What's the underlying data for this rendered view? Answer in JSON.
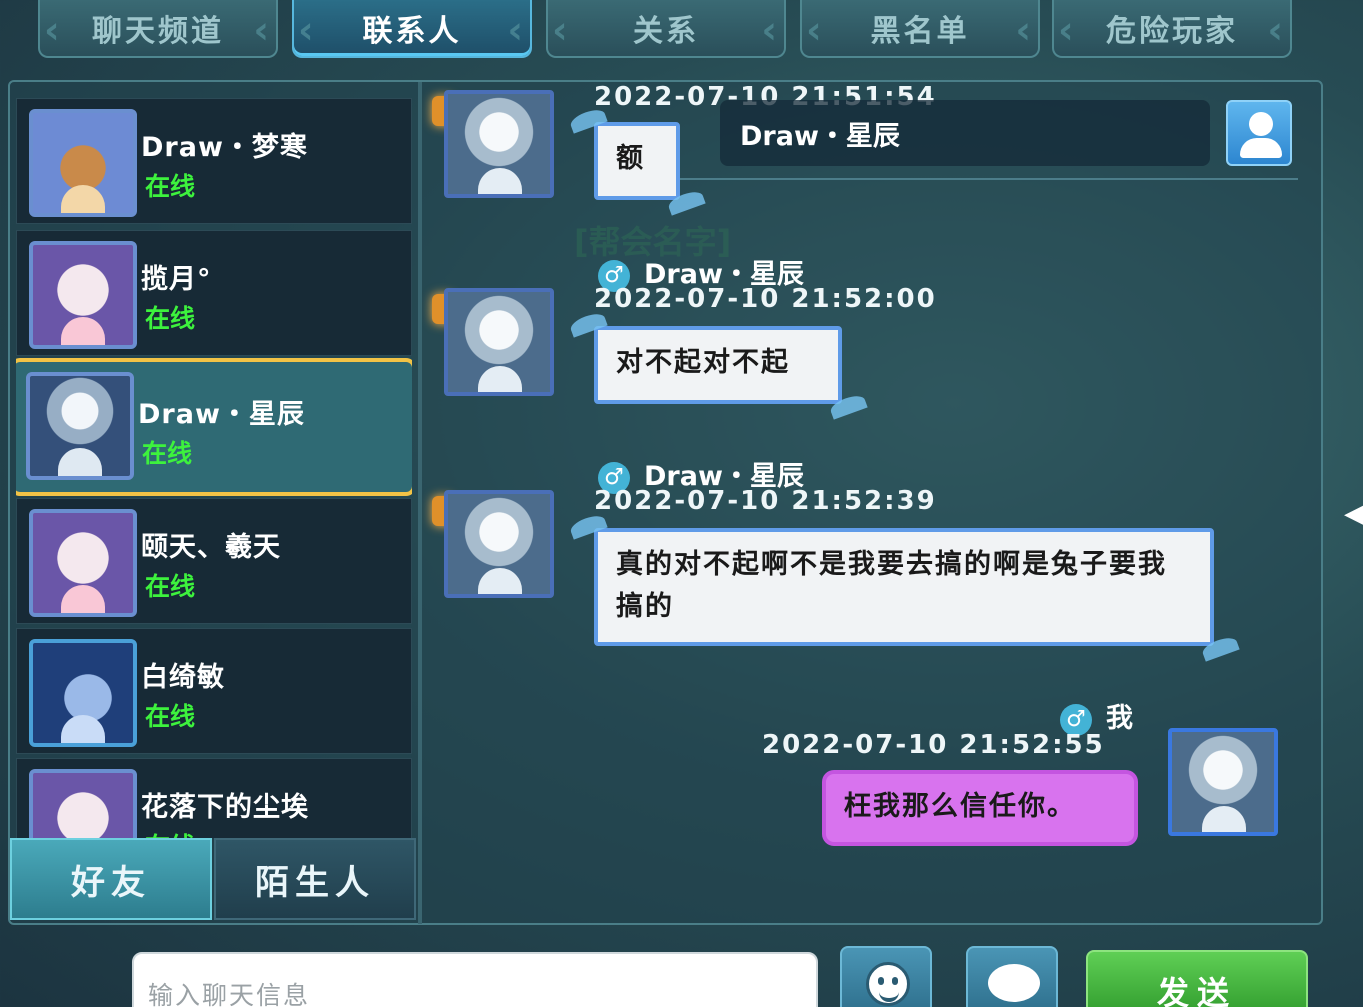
{
  "tabs": [
    {
      "label": "聊天频道",
      "active": false
    },
    {
      "label": "联系人",
      "active": true
    },
    {
      "label": "关系",
      "active": false
    },
    {
      "label": "黑名单",
      "active": false
    },
    {
      "label": "危险玩家",
      "active": false
    }
  ],
  "contacts": [
    {
      "name": "Draw・梦寒",
      "status": "在线",
      "avatar": "fox-avatar"
    },
    {
      "name": "揽月°",
      "status": "在线",
      "avatar": "sheep-avatar"
    },
    {
      "name": "Draw・星辰",
      "status": "在线",
      "avatar": "white-hair-avatar",
      "selected": true
    },
    {
      "name": "颐天、羲天",
      "status": "在线",
      "avatar": "sheep-avatar"
    },
    {
      "name": "白绮敏",
      "status": "在线",
      "avatar": "wolf-avatar"
    },
    {
      "name": "花落下的尘埃",
      "status": "在线",
      "avatar": "sheep-avatar"
    }
  ],
  "filter_tabs": {
    "friends": "好友",
    "strangers": "陌生人"
  },
  "chat": {
    "partner_name": "Draw・星辰",
    "ghost_text": "[帮会名字]",
    "messages": [
      {
        "sender": "",
        "time": "2022-07-10  21:51:54",
        "text": "额",
        "mine": false
      },
      {
        "sender": "Draw・星辰",
        "time": "2022-07-10  21:52:00",
        "text": "对不起对不起",
        "mine": false
      },
      {
        "sender": "Draw・星辰",
        "time": "2022-07-10  21:52:39",
        "text": "真的对不起啊不是我要去搞的啊是兔子要我搞的",
        "mine": false
      },
      {
        "sender": "我",
        "time": "2022-07-10  21:52:55",
        "text": "枉我那么信任你。",
        "mine": true
      }
    ],
    "gender_symbol": "♂"
  },
  "input": {
    "placeholder": "输入聊天信息",
    "value": ""
  },
  "send_label": "发送",
  "colors": {
    "accent_blue": "#5f9be8",
    "online_green": "#3df23d",
    "selected_border": "#f2c346",
    "my_bubble": "#d873ee",
    "send_green": "#2f9a2c"
  }
}
